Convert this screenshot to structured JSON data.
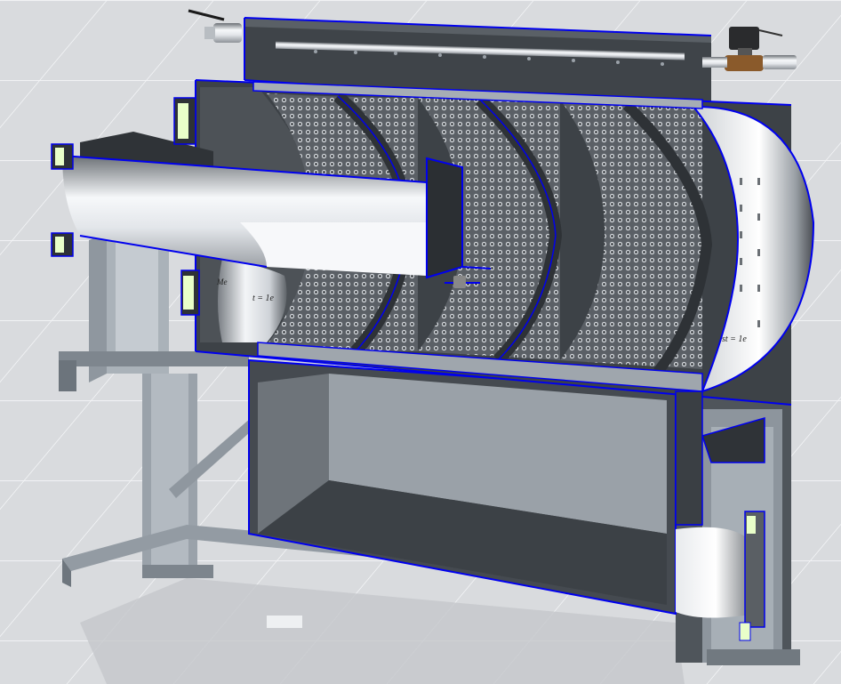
{
  "viewport": {
    "background": "#d9dbde",
    "grid_color": "#f2f3f5",
    "section_edge_color": "#0000ee"
  },
  "model": {
    "cut_surface_color": "#4b4f55",
    "steel_light": "#f4f6f8",
    "steel_dark": "#5a5e63",
    "frame_color": "#9ea6ae",
    "flange_face_color": "#e9ffc9",
    "valve_body_color": "#8a5a2b"
  },
  "dimension_labels": {
    "inner_drum": "t = 1e",
    "outer_drum": "st = 1e",
    "flange_tag": "Me"
  }
}
